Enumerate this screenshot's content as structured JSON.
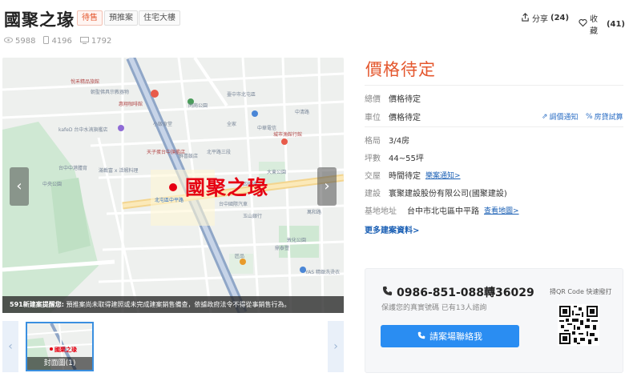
{
  "header": {
    "title": "國聚之瑑",
    "tags": [
      "待售",
      "預推案",
      "住宅大樓"
    ],
    "share_label": "分享",
    "share_count": "(24)",
    "fav_label": "收藏",
    "fav_count": "(41)"
  },
  "stats": {
    "views": "5988",
    "phone_views": "4196",
    "messages": "1792"
  },
  "map": {
    "project_label": "國聚之瑑",
    "notice_prefix": "591新建案提醒您:",
    "notice_text": " 預推案尚未取得建照或未完成建案銷售備查，依據政府法令不得從事銷售行為。",
    "places": [
      "悅禾精品旅館",
      "朝聖佛具宗教器物",
      "臺中市北屯區",
      "惠翔咖啡館",
      "同崗公園",
      "北平路三段",
      "中清路",
      "四平路",
      "大東公園",
      "萬和路",
      "中華電信",
      "全家",
      "城市漁館行館",
      "kafeD 台中水湳旗艦店",
      "小飯食堂",
      "天子蛋台中旗艦店",
      "滿載富 x 活蝦料理",
      "鮮喜飯店",
      "北屯區中平路",
      "台中中港體育",
      "玉山銀行",
      "中央公園",
      "鼎泰豐",
      "台中國際汽車",
      "YAS 精緻洗烫衣",
      "敦化公園",
      "匠品"
    ]
  },
  "thumbs": {
    "caption": "封面圖(1)",
    "mini_label": "國聚之瑑"
  },
  "info": {
    "price": "價格待定",
    "rows": [
      {
        "k": "總價",
        "v": "價格待定"
      },
      {
        "k": "車位",
        "v": "價格待定"
      },
      {
        "k": "格局",
        "v": "3/4房"
      },
      {
        "k": "坪數",
        "v": "44~55坪"
      },
      {
        "k": "交屋",
        "v": "時間待定"
      },
      {
        "k": "建設",
        "v": "寰聚建設股份有限公司(國聚建設)"
      },
      {
        "k": "基地地址",
        "v": "台中市北屯區中平路"
      }
    ],
    "price_alert": "調價通知",
    "mortgage": "房貸試算",
    "delivery_link": "樂案通知>",
    "map_link": "查看地圖>",
    "more": "更多建案資料>"
  },
  "contact": {
    "phone": "0986-851-088轉36029",
    "sub": "保護您的真實號碼 已有13人諮詢",
    "call_label": "請案場聯絡我",
    "qr_title": "掃QR Code 快速撥打"
  },
  "colors": {
    "accent": "#e4572e",
    "project_red": "#e60012",
    "blue": "#2a8df2",
    "link": "#1a5fb4"
  }
}
